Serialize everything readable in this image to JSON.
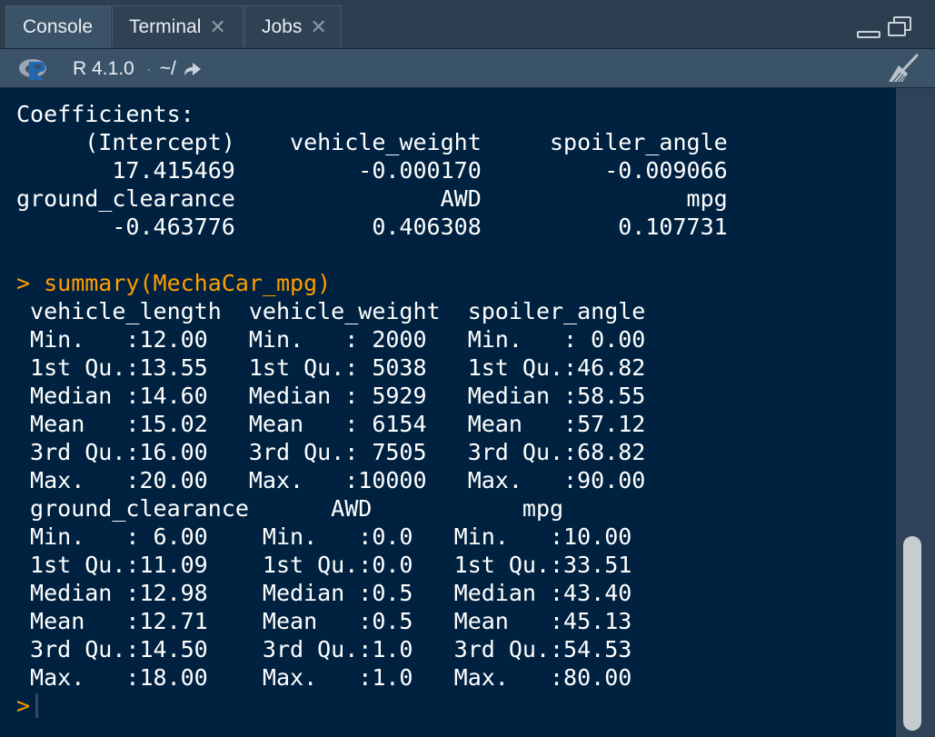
{
  "tabs": [
    {
      "label": "Console",
      "active": true,
      "closable": false
    },
    {
      "label": "Terminal",
      "active": false,
      "closable": true
    },
    {
      "label": "Jobs",
      "active": false,
      "closable": true
    }
  ],
  "toolbar": {
    "r_version": "R 4.1.0",
    "separator": "·",
    "working_dir": "~/"
  },
  "console": {
    "lines": [
      {
        "text": "Coefficients:",
        "kind": "output"
      },
      {
        "text": "     (Intercept)    vehicle_weight     spoiler_angle",
        "kind": "output"
      },
      {
        "text": "       17.415469         -0.000170         -0.009066",
        "kind": "output"
      },
      {
        "text": "ground_clearance               AWD               mpg",
        "kind": "output"
      },
      {
        "text": "       -0.463776          0.406308          0.107731",
        "kind": "output"
      },
      {
        "text": "",
        "kind": "output"
      },
      {
        "text": "> summary(MechaCar_mpg)",
        "kind": "command"
      },
      {
        "text": " vehicle_length  vehicle_weight  spoiler_angle",
        "kind": "output"
      },
      {
        "text": " Min.   :12.00   Min.   : 2000   Min.   : 0.00",
        "kind": "output"
      },
      {
        "text": " 1st Qu.:13.55   1st Qu.: 5038   1st Qu.:46.82",
        "kind": "output"
      },
      {
        "text": " Median :14.60   Median : 5929   Median :58.55",
        "kind": "output"
      },
      {
        "text": " Mean   :15.02   Mean   : 6154   Mean   :57.12",
        "kind": "output"
      },
      {
        "text": " 3rd Qu.:16.00   3rd Qu.: 7505   3rd Qu.:68.82",
        "kind": "output"
      },
      {
        "text": " Max.   :20.00   Max.   :10000   Max.   :90.00",
        "kind": "output"
      },
      {
        "text": " ground_clearance      AWD           mpg",
        "kind": "output"
      },
      {
        "text": " Min.   : 6.00    Min.   :0.0   Min.   :10.00",
        "kind": "output"
      },
      {
        "text": " 1st Qu.:11.09    1st Qu.:0.0   1st Qu.:33.51",
        "kind": "output"
      },
      {
        "text": " Median :12.98    Median :0.5   Median :43.40",
        "kind": "output"
      },
      {
        "text": " Mean   :12.71    Mean   :0.5   Mean   :45.13",
        "kind": "output"
      },
      {
        "text": " 3rd Qu.:14.50    3rd Qu.:1.0   3rd Qu.:54.53",
        "kind": "output"
      },
      {
        "text": " Max.   :18.00    Max.   :1.0   Max.   :80.00",
        "kind": "output"
      }
    ],
    "prompt": ">"
  },
  "colors": {
    "console_bg": "#002240",
    "command_text": "#ff9d00",
    "output_text": "#ffffff"
  },
  "icons": {
    "r_logo": "r-logo-icon",
    "goto_dir": "goto-directory-icon",
    "clear_console": "broom-icon",
    "minimize": "minimize-icon",
    "maximize": "maximize-icon"
  }
}
